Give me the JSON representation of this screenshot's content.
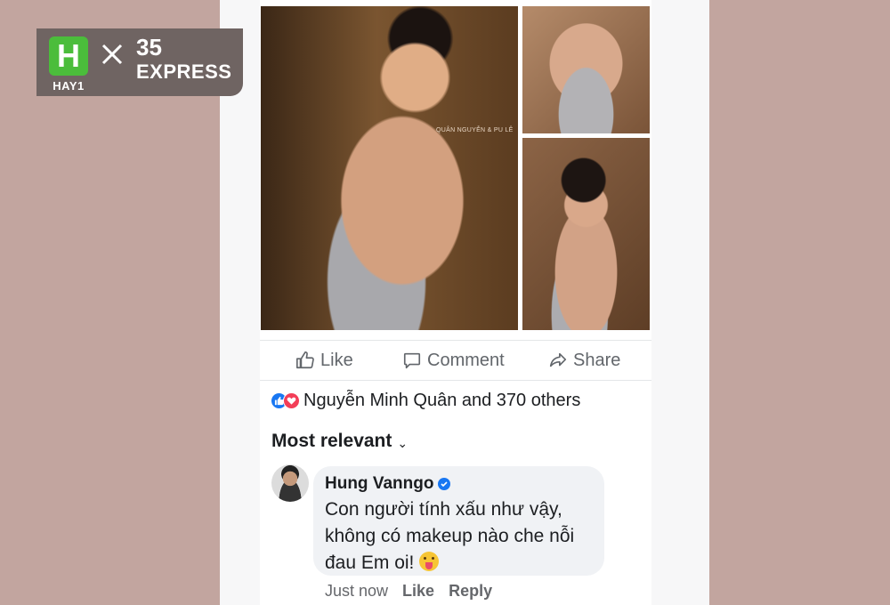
{
  "logo": {
    "left_mark": "H",
    "left_name": "HAY1",
    "right_number": "35",
    "right_word": "EXPRESS"
  },
  "photos": {
    "watermark": "QUÂN NGUYỄN & PU LÊ"
  },
  "actions": {
    "like": "Like",
    "comment": "Comment",
    "share": "Share"
  },
  "reactions": {
    "summary": "Nguyễn Minh Quân and 370 others"
  },
  "comments": {
    "sort_label": "Most relevant",
    "items": [
      {
        "author": "Hung Vanngo",
        "text": "Con người tính xấu như vậy, không có makeup nào che nỗi đau Em oi!",
        "emoji": "tongue-out-emoji",
        "time": "Just now",
        "like_label": "Like",
        "reply_label": "Reply"
      }
    ]
  },
  "colors": {
    "background": "#c2a59f",
    "accent_blue": "#1877f2",
    "love_red": "#f33e58",
    "logo_green": "#4bbd3b"
  }
}
